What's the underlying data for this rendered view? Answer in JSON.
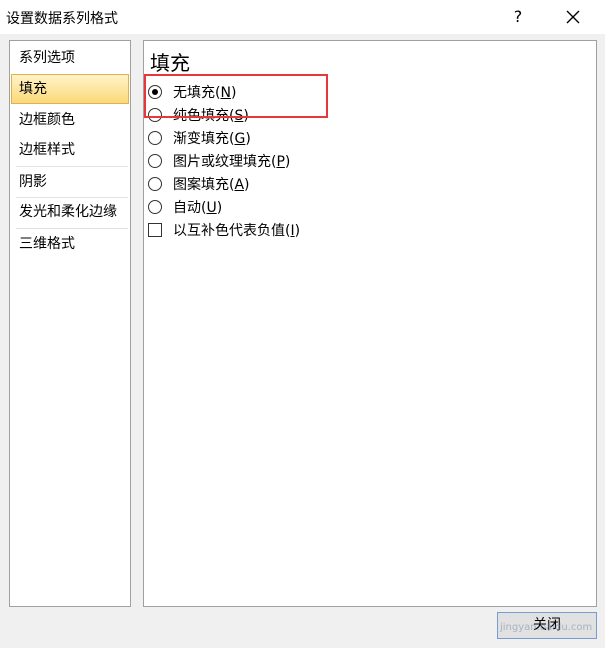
{
  "window": {
    "title": "设置数据系列格式",
    "help_label": "?",
    "close_button_label": "关闭"
  },
  "sidebar": {
    "items": [
      {
        "label": "系列选项",
        "selected": false
      },
      {
        "label": "填充",
        "selected": true
      },
      {
        "label": "边框颜色",
        "selected": false
      },
      {
        "label": "边框样式",
        "selected": false
      },
      {
        "label": "阴影",
        "selected": false
      },
      {
        "label": "发光和柔化边缘",
        "selected": false
      },
      {
        "label": "三维格式",
        "selected": false
      }
    ]
  },
  "main": {
    "section_title": "填充",
    "options": [
      {
        "label": "无填充",
        "hotkey": "N",
        "type": "radio",
        "checked": true
      },
      {
        "label": "纯色填充",
        "hotkey": "S",
        "type": "radio",
        "checked": false
      },
      {
        "label": "渐变填充",
        "hotkey": "G",
        "type": "radio",
        "checked": false
      },
      {
        "label": "图片或纹理填充",
        "hotkey": "P",
        "type": "radio",
        "checked": false
      },
      {
        "label": "图案填充",
        "hotkey": "A",
        "type": "radio",
        "checked": false
      },
      {
        "label": "自动",
        "hotkey": "U",
        "type": "radio",
        "checked": false
      },
      {
        "label": "以互补色代表负值",
        "hotkey": "I",
        "type": "checkbox",
        "checked": false
      }
    ]
  },
  "annotation": {
    "color": "#e8363b"
  },
  "watermark": "jingyan.baidu.com"
}
